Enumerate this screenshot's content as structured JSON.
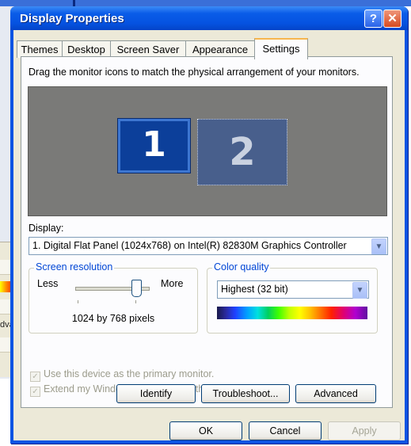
{
  "background": {
    "partial_text": "dva"
  },
  "window": {
    "title": "Display Properties",
    "help_glyph": "?",
    "close_glyph": "✕"
  },
  "tabs": [
    {
      "label": "Themes"
    },
    {
      "label": "Desktop"
    },
    {
      "label": "Screen Saver"
    },
    {
      "label": "Appearance"
    },
    {
      "label": "Settings",
      "active": true
    }
  ],
  "settings": {
    "instruction": "Drag the monitor icons to match the physical arrangement of your monitors.",
    "monitors": [
      "1",
      "2"
    ],
    "display_label": "Display:",
    "display_value": "1. Digital Flat Panel (1024x768) on Intel(R) 82830M Graphics Controller",
    "resolution": {
      "title": "Screen resolution",
      "less": "Less",
      "more": "More",
      "value": "1024 by 768 pixels"
    },
    "color": {
      "title": "Color quality",
      "value": "Highest (32 bit)"
    },
    "checkboxes": [
      {
        "label": "Use this device as the primary monitor.",
        "checked": true,
        "enabled": false
      },
      {
        "label": "Extend my Windows desktop onto this monitor.",
        "checked": true,
        "enabled": false
      }
    ],
    "buttons": {
      "identify": "Identify",
      "troubleshoot": "Troubleshoot...",
      "advanced": "Advanced"
    }
  },
  "footer": {
    "ok": "OK",
    "cancel": "Cancel",
    "apply": "Apply"
  },
  "colors": {
    "titlebar": "#0a54e3",
    "tab_highlight": "#f7b54d",
    "group_title": "#0046d5"
  }
}
